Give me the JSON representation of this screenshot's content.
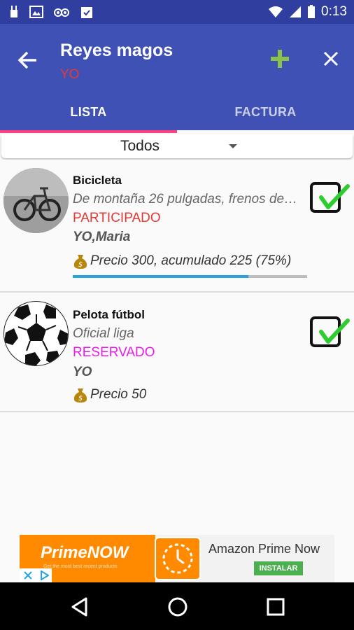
{
  "status_bar": {
    "time": "0:13"
  },
  "app_bar": {
    "title": "Reyes magos",
    "subtitle": "YO",
    "tabs": [
      {
        "label": "LISTA",
        "active": true
      },
      {
        "label": "FACTURA",
        "active": false
      }
    ]
  },
  "filter": {
    "selected": "Todos"
  },
  "items": [
    {
      "name": "Bicicleta",
      "description": "De montaña 26 pulgadas,  frenos de…",
      "status": "PARTICIPADO",
      "status_color": "#e53935",
      "people": "YO,Maria",
      "price": "Precio 300, acumulado 225 (75%)",
      "progress": 0.75,
      "checked": true
    },
    {
      "name": "Pelota fútbol",
      "description": "Oficial liga",
      "status": "RESERVADO",
      "status_color": "#e91ee6",
      "people": "YO",
      "price": "Precio 50",
      "checked": true
    }
  ],
  "ad": {
    "brand": "PrimeNOW",
    "tagline": "Get the most best recent products",
    "title": "Amazon Prime Now",
    "install_label": "INSTALAR"
  },
  "colors": {
    "primary": "#3f51b5",
    "primary_dark": "#303f9f",
    "accent": "#ff4081",
    "add_icon": "#8bc34a",
    "check_icon": "#2ecc2e",
    "progress": "#29a3dd"
  }
}
